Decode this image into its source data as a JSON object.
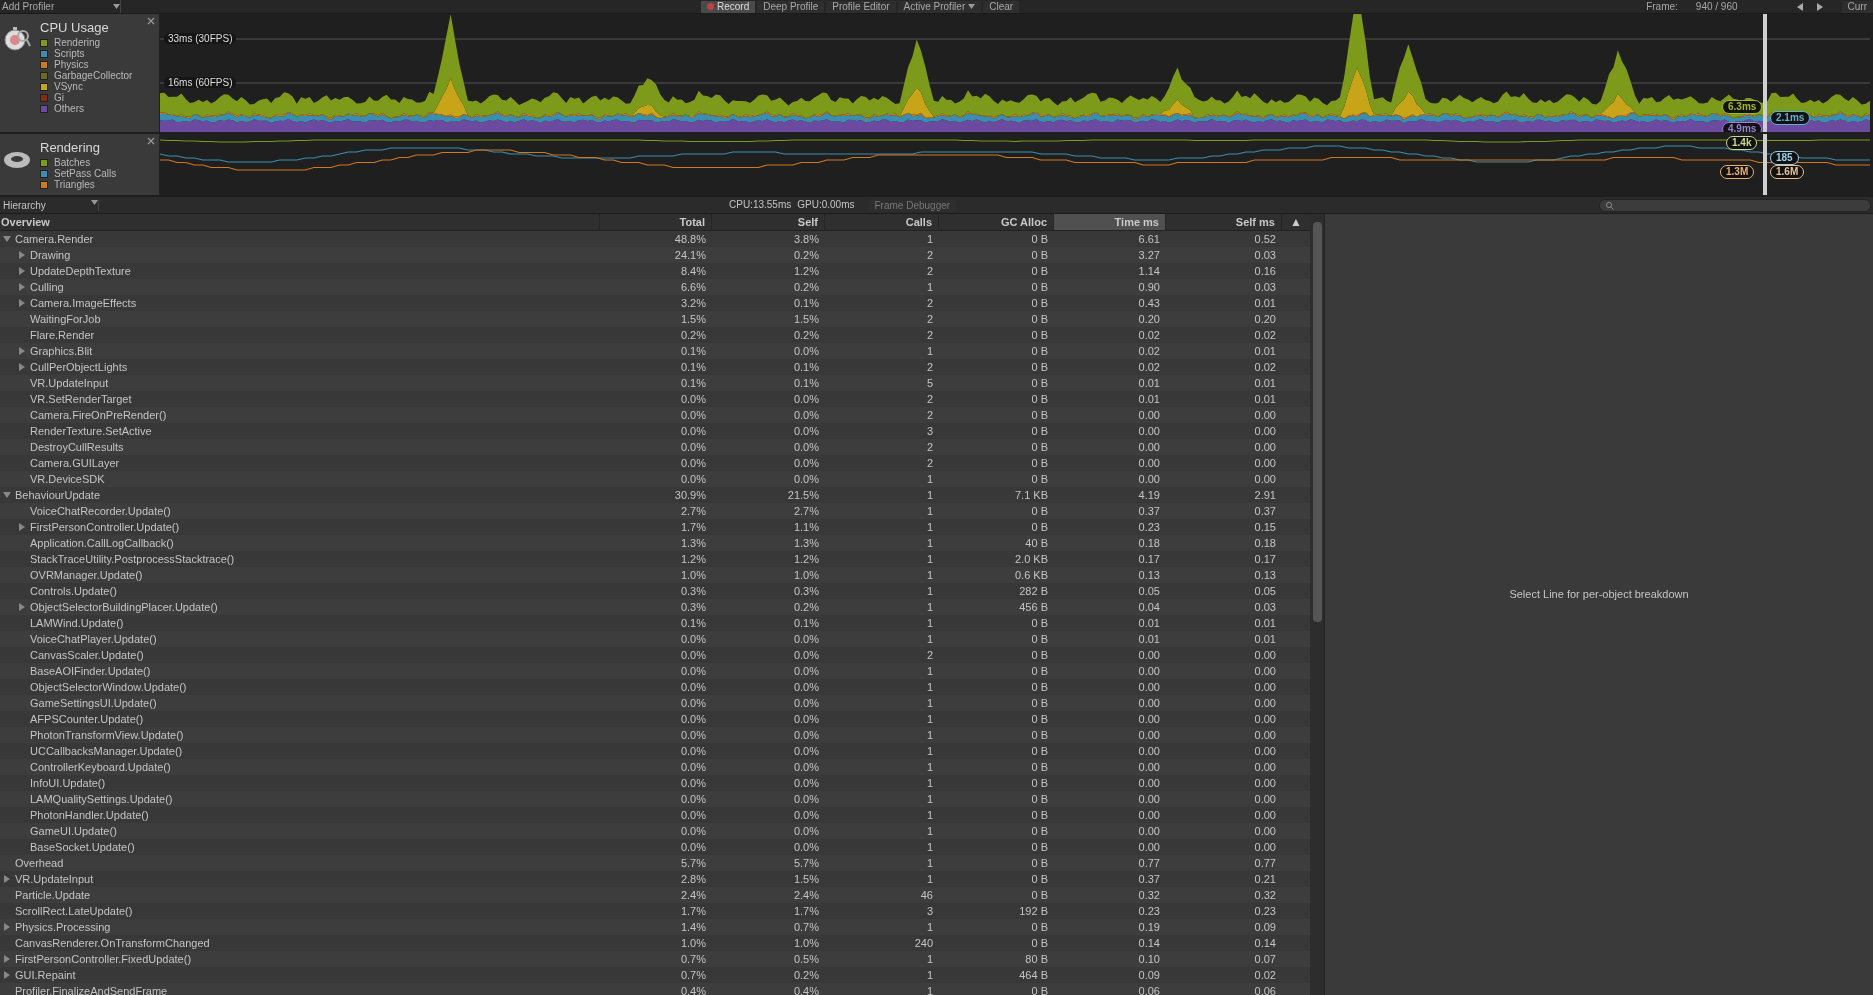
{
  "toolbar": {
    "add_profiler": "Add Profiler",
    "buttons": [
      {
        "label": "Record",
        "kind": "record",
        "selected": true
      },
      {
        "label": "Deep Profile",
        "kind": "toggle",
        "selected": false
      },
      {
        "label": "Profile Editor",
        "kind": "toggle",
        "selected": false
      },
      {
        "label": "Active Profiler",
        "kind": "dropdown",
        "selected": false
      },
      {
        "label": "Clear",
        "kind": "button",
        "selected": false
      }
    ],
    "frame_label": "Frame:",
    "frame_value": "940 / 960",
    "current": "Curr"
  },
  "profilers": [
    {
      "kind": "cpu",
      "title": "CPU Usage",
      "legend": [
        {
          "label": "Rendering",
          "color": "#7d9a1b"
        },
        {
          "label": "Scripts",
          "color": "#3a8fb0"
        },
        {
          "label": "Physics",
          "color": "#d07820"
        },
        {
          "label": "GarbageCollector",
          "color": "#6b6a1e"
        },
        {
          "label": "VSync",
          "color": "#c8a418"
        },
        {
          "label": "Gi",
          "color": "#8a2a10"
        },
        {
          "label": "Others",
          "color": "#6c4aa0"
        }
      ],
      "grid_labels": [
        "33ms (30FPS)",
        "16ms (60FPS)"
      ],
      "readings": [
        {
          "text": "6.3ms",
          "color": "#9ab82a"
        },
        {
          "text": "4.9ms",
          "color": "#9a80d0"
        },
        {
          "text": "2.1ms",
          "color": "#5fb0d0"
        }
      ]
    },
    {
      "kind": "rendering",
      "title": "Rendering",
      "legend": [
        {
          "label": "Batches",
          "color": "#7d9a1b"
        },
        {
          "label": "SetPass Calls",
          "color": "#3a8fb0"
        },
        {
          "label": "Triangles",
          "color": "#d07820"
        }
      ],
      "readings": [
        {
          "text": "1.4k",
          "color": "#c8d890"
        },
        {
          "text": "185",
          "color": "#9cd0e8"
        },
        {
          "text": "1.3M",
          "color": "#e8b070"
        },
        {
          "text": "1.6M",
          "color": "#e8c090"
        }
      ]
    }
  ],
  "hierarchy_bar": {
    "view": "Hierarchy",
    "cpu": "CPU:13.55ms",
    "gpu": "GPU:0.00ms",
    "frame_debugger": "Frame Debugger"
  },
  "table": {
    "columns": [
      {
        "label": "Overview",
        "selected": false
      },
      {
        "label": "Total",
        "selected": false
      },
      {
        "label": "Self",
        "selected": false
      },
      {
        "label": "Calls",
        "selected": false
      },
      {
        "label": "GC Alloc",
        "selected": false
      },
      {
        "label": "Time ms",
        "selected": true
      },
      {
        "label": "Self ms",
        "selected": false
      }
    ],
    "sort_indicator": "▲",
    "rows": [
      {
        "name": "Camera.Render",
        "total": "48.8%",
        "self": "3.8%",
        "calls": "1",
        "gc_alloc": "0 B",
        "time_ms": "6.61",
        "self_ms": "0.52",
        "kind": "expanded",
        "children": [
          {
            "name": "Drawing",
            "total": "24.1%",
            "self": "0.2%",
            "calls": "2",
            "gc_alloc": "0 B",
            "time_ms": "3.27",
            "self_ms": "0.03",
            "kind": "collapsed"
          },
          {
            "name": "UpdateDepthTexture",
            "total": "8.4%",
            "self": "1.2%",
            "calls": "2",
            "gc_alloc": "0 B",
            "time_ms": "1.14",
            "self_ms": "0.16",
            "kind": "collapsed"
          },
          {
            "name": "Culling",
            "total": "6.6%",
            "self": "0.2%",
            "calls": "1",
            "gc_alloc": "0 B",
            "time_ms": "0.90",
            "self_ms": "0.03",
            "kind": "collapsed"
          },
          {
            "name": "Camera.ImageEffects",
            "total": "3.2%",
            "self": "0.1%",
            "calls": "2",
            "gc_alloc": "0 B",
            "time_ms": "0.43",
            "self_ms": "0.01",
            "kind": "collapsed"
          },
          {
            "name": "WaitingForJob",
            "total": "1.5%",
            "self": "1.5%",
            "calls": "2",
            "gc_alloc": "0 B",
            "time_ms": "0.20",
            "self_ms": "0.20",
            "kind": "leaf"
          },
          {
            "name": "Flare.Render",
            "total": "0.2%",
            "self": "0.2%",
            "calls": "2",
            "gc_alloc": "0 B",
            "time_ms": "0.02",
            "self_ms": "0.02",
            "kind": "leaf"
          },
          {
            "name": "Graphics.Blit",
            "total": "0.1%",
            "self": "0.0%",
            "calls": "1",
            "gc_alloc": "0 B",
            "time_ms": "0.02",
            "self_ms": "0.01",
            "kind": "collapsed"
          },
          {
            "name": "CullPerObjectLights",
            "total": "0.1%",
            "self": "0.1%",
            "calls": "2",
            "gc_alloc": "0 B",
            "time_ms": "0.02",
            "self_ms": "0.02",
            "kind": "collapsed"
          },
          {
            "name": "VR.UpdateInput",
            "total": "0.1%",
            "self": "0.1%",
            "calls": "5",
            "gc_alloc": "0 B",
            "time_ms": "0.01",
            "self_ms": "0.01",
            "kind": "leaf"
          },
          {
            "name": "VR.SetRenderTarget",
            "total": "0.0%",
            "self": "0.0%",
            "calls": "2",
            "gc_alloc": "0 B",
            "time_ms": "0.01",
            "self_ms": "0.01",
            "kind": "leaf"
          },
          {
            "name": "Camera.FireOnPreRender()",
            "total": "0.0%",
            "self": "0.0%",
            "calls": "2",
            "gc_alloc": "0 B",
            "time_ms": "0.00",
            "self_ms": "0.00",
            "kind": "leaf"
          },
          {
            "name": "RenderTexture.SetActive",
            "total": "0.0%",
            "self": "0.0%",
            "calls": "3",
            "gc_alloc": "0 B",
            "time_ms": "0.00",
            "self_ms": "0.00",
            "kind": "leaf"
          },
          {
            "name": "DestroyCullResults",
            "total": "0.0%",
            "self": "0.0%",
            "calls": "2",
            "gc_alloc": "0 B",
            "time_ms": "0.00",
            "self_ms": "0.00",
            "kind": "leaf"
          },
          {
            "name": "Camera.GUILayer",
            "total": "0.0%",
            "self": "0.0%",
            "calls": "2",
            "gc_alloc": "0 B",
            "time_ms": "0.00",
            "self_ms": "0.00",
            "kind": "leaf"
          },
          {
            "name": "VR.DeviceSDK",
            "total": "0.0%",
            "self": "0.0%",
            "calls": "1",
            "gc_alloc": "0 B",
            "time_ms": "0.00",
            "self_ms": "0.00",
            "kind": "leaf"
          }
        ]
      },
      {
        "name": "BehaviourUpdate",
        "total": "30.9%",
        "self": "21.5%",
        "calls": "1",
        "gc_alloc": "7.1 KB",
        "time_ms": "4.19",
        "self_ms": "2.91",
        "kind": "expanded",
        "children": [
          {
            "name": "VoiceChatRecorder.Update()",
            "total": "2.7%",
            "self": "2.7%",
            "calls": "1",
            "gc_alloc": "0 B",
            "time_ms": "0.37",
            "self_ms": "0.37",
            "kind": "leaf"
          },
          {
            "name": "FirstPersonController.Update()",
            "total": "1.7%",
            "self": "1.1%",
            "calls": "1",
            "gc_alloc": "0 B",
            "time_ms": "0.23",
            "self_ms": "0.15",
            "kind": "collapsed"
          },
          {
            "name": "Application.CallLogCallback()",
            "total": "1.3%",
            "self": "1.3%",
            "calls": "1",
            "gc_alloc": "40 B",
            "time_ms": "0.18",
            "self_ms": "0.18",
            "kind": "leaf"
          },
          {
            "name": "StackTraceUtility.PostprocessStacktrace()",
            "total": "1.2%",
            "self": "1.2%",
            "calls": "1",
            "gc_alloc": "2.0 KB",
            "time_ms": "0.17",
            "self_ms": "0.17",
            "kind": "leaf"
          },
          {
            "name": "OVRManager.Update()",
            "total": "1.0%",
            "self": "1.0%",
            "calls": "1",
            "gc_alloc": "0.6 KB",
            "time_ms": "0.13",
            "self_ms": "0.13",
            "kind": "leaf"
          },
          {
            "name": "Controls.Update()",
            "total": "0.3%",
            "self": "0.3%",
            "calls": "1",
            "gc_alloc": "282 B",
            "time_ms": "0.05",
            "self_ms": "0.05",
            "kind": "leaf"
          },
          {
            "name": "ObjectSelectorBuildingPlacer.Update()",
            "total": "0.3%",
            "self": "0.2%",
            "calls": "1",
            "gc_alloc": "456 B",
            "time_ms": "0.04",
            "self_ms": "0.03",
            "kind": "collapsed"
          },
          {
            "name": "LAMWind.Update()",
            "total": "0.1%",
            "self": "0.1%",
            "calls": "1",
            "gc_alloc": "0 B",
            "time_ms": "0.01",
            "self_ms": "0.01",
            "kind": "leaf"
          },
          {
            "name": "VoiceChatPlayer.Update()",
            "total": "0.0%",
            "self": "0.0%",
            "calls": "1",
            "gc_alloc": "0 B",
            "time_ms": "0.01",
            "self_ms": "0.01",
            "kind": "leaf"
          },
          {
            "name": "CanvasScaler.Update()",
            "total": "0.0%",
            "self": "0.0%",
            "calls": "2",
            "gc_alloc": "0 B",
            "time_ms": "0.00",
            "self_ms": "0.00",
            "kind": "leaf"
          },
          {
            "name": "BaseAOIFinder.Update()",
            "total": "0.0%",
            "self": "0.0%",
            "calls": "1",
            "gc_alloc": "0 B",
            "time_ms": "0.00",
            "self_ms": "0.00",
            "kind": "leaf"
          },
          {
            "name": "ObjectSelectorWindow.Update()",
            "total": "0.0%",
            "self": "0.0%",
            "calls": "1",
            "gc_alloc": "0 B",
            "time_ms": "0.00",
            "self_ms": "0.00",
            "kind": "leaf"
          },
          {
            "name": "GameSettingsUI.Update()",
            "total": "0.0%",
            "self": "0.0%",
            "calls": "1",
            "gc_alloc": "0 B",
            "time_ms": "0.00",
            "self_ms": "0.00",
            "kind": "leaf"
          },
          {
            "name": "AFPSCounter.Update()",
            "total": "0.0%",
            "self": "0.0%",
            "calls": "1",
            "gc_alloc": "0 B",
            "time_ms": "0.00",
            "self_ms": "0.00",
            "kind": "leaf"
          },
          {
            "name": "PhotonTransformView.Update()",
            "total": "0.0%",
            "self": "0.0%",
            "calls": "1",
            "gc_alloc": "0 B",
            "time_ms": "0.00",
            "self_ms": "0.00",
            "kind": "leaf"
          },
          {
            "name": "UCCallbacksManager.Update()",
            "total": "0.0%",
            "self": "0.0%",
            "calls": "1",
            "gc_alloc": "0 B",
            "time_ms": "0.00",
            "self_ms": "0.00",
            "kind": "leaf"
          },
          {
            "name": "ControllerKeyboard.Update()",
            "total": "0.0%",
            "self": "0.0%",
            "calls": "1",
            "gc_alloc": "0 B",
            "time_ms": "0.00",
            "self_ms": "0.00",
            "kind": "leaf"
          },
          {
            "name": "InfoUI.Update()",
            "total": "0.0%",
            "self": "0.0%",
            "calls": "1",
            "gc_alloc": "0 B",
            "time_ms": "0.00",
            "self_ms": "0.00",
            "kind": "leaf"
          },
          {
            "name": "LAMQualitySettings.Update()",
            "total": "0.0%",
            "self": "0.0%",
            "calls": "1",
            "gc_alloc": "0 B",
            "time_ms": "0.00",
            "self_ms": "0.00",
            "kind": "leaf"
          },
          {
            "name": "PhotonHandler.Update()",
            "total": "0.0%",
            "self": "0.0%",
            "calls": "1",
            "gc_alloc": "0 B",
            "time_ms": "0.00",
            "self_ms": "0.00",
            "kind": "leaf"
          },
          {
            "name": "GameUI.Update()",
            "total": "0.0%",
            "self": "0.0%",
            "calls": "1",
            "gc_alloc": "0 B",
            "time_ms": "0.00",
            "self_ms": "0.00",
            "kind": "leaf"
          },
          {
            "name": "BaseSocket.Update()",
            "total": "0.0%",
            "self": "0.0%",
            "calls": "1",
            "gc_alloc": "0 B",
            "time_ms": "0.00",
            "self_ms": "0.00",
            "kind": "leaf"
          }
        ]
      },
      {
        "name": "Overhead",
        "total": "5.7%",
        "self": "5.7%",
        "calls": "1",
        "gc_alloc": "0 B",
        "time_ms": "0.77",
        "self_ms": "0.77",
        "kind": "leaf"
      },
      {
        "name": "VR.UpdateInput",
        "total": "2.8%",
        "self": "1.5%",
        "calls": "1",
        "gc_alloc": "0 B",
        "time_ms": "0.37",
        "self_ms": "0.21",
        "kind": "collapsed"
      },
      {
        "name": "Particle.Update",
        "total": "2.4%",
        "self": "2.4%",
        "calls": "46",
        "gc_alloc": "0 B",
        "time_ms": "0.32",
        "self_ms": "0.32",
        "kind": "leaf"
      },
      {
        "name": "ScrollRect.LateUpdate()",
        "total": "1.7%",
        "self": "1.7%",
        "calls": "3",
        "gc_alloc": "192 B",
        "time_ms": "0.23",
        "self_ms": "0.23",
        "kind": "leaf"
      },
      {
        "name": "Physics.Processing",
        "total": "1.4%",
        "self": "0.7%",
        "calls": "1",
        "gc_alloc": "0 B",
        "time_ms": "0.19",
        "self_ms": "0.09",
        "kind": "collapsed"
      },
      {
        "name": "CanvasRenderer.OnTransformChanged",
        "total": "1.0%",
        "self": "1.0%",
        "calls": "240",
        "gc_alloc": "0 B",
        "time_ms": "0.14",
        "self_ms": "0.14",
        "kind": "leaf"
      },
      {
        "name": "FirstPersonController.FixedUpdate()",
        "total": "0.7%",
        "self": "0.5%",
        "calls": "1",
        "gc_alloc": "80 B",
        "time_ms": "0.10",
        "self_ms": "0.07",
        "kind": "collapsed"
      },
      {
        "name": "GUI.Repaint",
        "total": "0.7%",
        "self": "0.2%",
        "calls": "1",
        "gc_alloc": "464 B",
        "time_ms": "0.09",
        "self_ms": "0.02",
        "kind": "collapsed"
      },
      {
        "name": "Profiler.FinalizeAndSendFrame",
        "total": "0.4%",
        "self": "0.4%",
        "calls": "1",
        "gc_alloc": "0 B",
        "time_ms": "0.06",
        "self_ms": "0.06",
        "kind": "leaf"
      }
    ]
  },
  "details": {
    "message": "Select Line for per-object breakdown"
  }
}
